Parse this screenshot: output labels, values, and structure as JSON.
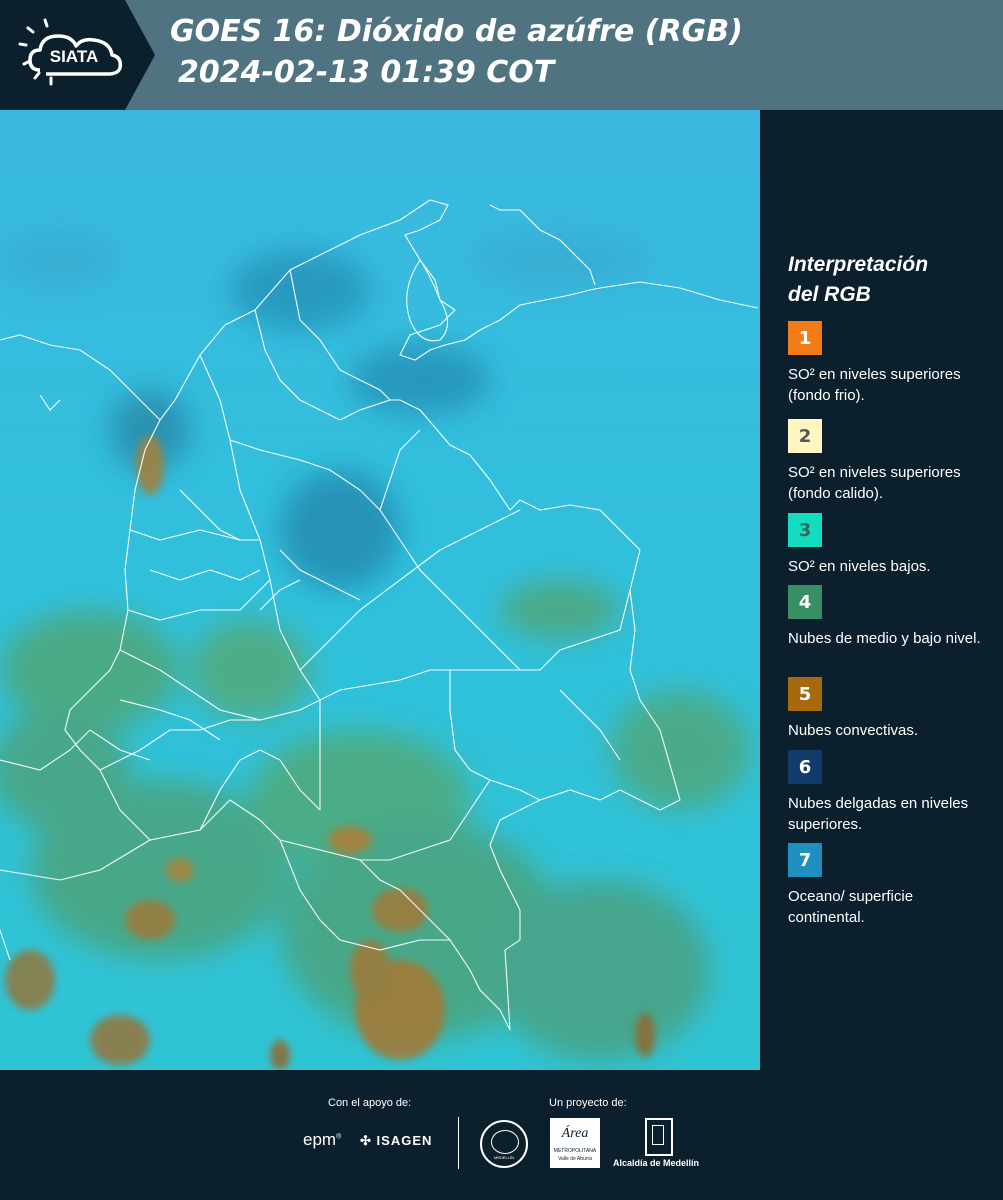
{
  "header": {
    "logo_text": "SIATA",
    "title_line1": "GOES 16: Dióxido de azúfre (RGB)",
    "title_line2": "2024-02-13 01:39 COT"
  },
  "legend": {
    "title_line1": "Interpretación",
    "title_line2": "del RGB",
    "items": [
      {
        "number": "1",
        "color": "#f47c16",
        "text": "SO² en niveles superiores (fondo frio)."
      },
      {
        "number": "2",
        "color": "#fff5c2",
        "text": "SO² en niveles superiores (fondo calido)."
      },
      {
        "number": "3",
        "color": "#14dcc0",
        "text": "SO² en niveles bajos."
      },
      {
        "number": "4",
        "color": "#3a8e63",
        "text": "Nubes de medio y bajo nivel."
      },
      {
        "number": "5",
        "color": "#a8680e",
        "text": "Nubes convectivas."
      },
      {
        "number": "6",
        "color": "#123a6b",
        "text": "Nubes delgadas en niveles superiores."
      },
      {
        "number": "7",
        "color": "#1f8fc0",
        "text": "Oceano/ superficie continental."
      }
    ]
  },
  "footer": {
    "support_label": "Con el apoyo de:",
    "project_label": "Un proyecto de:",
    "sponsor_1": "epm",
    "sponsor_2": "ISAGEN",
    "partner_seal_text": "MEDELLÍN",
    "partner_area_1": "Área",
    "partner_area_2": "METROPOLITANA",
    "partner_area_3": "Valle de Aburrá",
    "partner_alcaldia": "Alcaldía de Medellín"
  },
  "colors": {
    "header_bg": "#4f7381",
    "panel_bg": "#0c1f2d",
    "ocean": "#32b6dc",
    "land_green": "#4e9d6a",
    "cloud_brown": "#9e7a3c",
    "border_lines": "#ffffff"
  }
}
